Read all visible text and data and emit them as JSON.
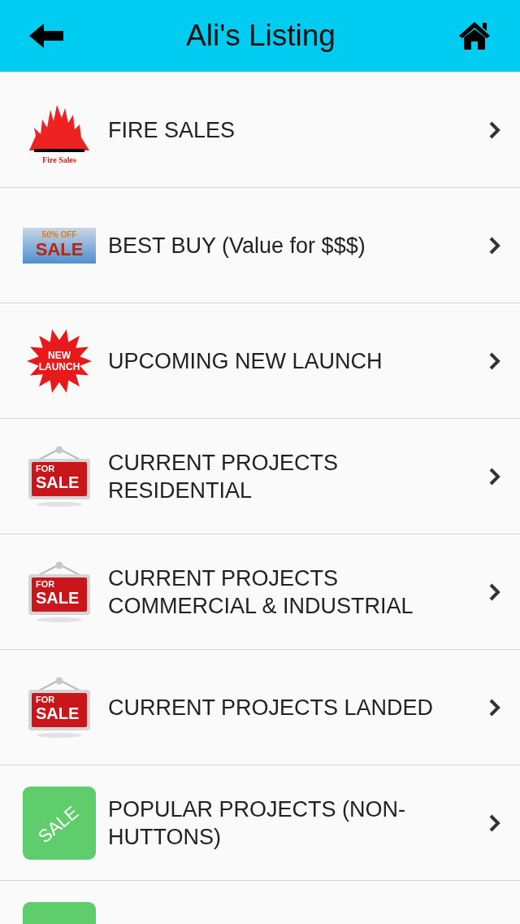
{
  "header": {
    "title": "Ali's Listing"
  },
  "items": [
    {
      "label": "FIRE SALES",
      "icon": {
        "kind": "fire",
        "lines": [
          "Fire Sales"
        ]
      }
    },
    {
      "label": "BEST BUY (Value for $$$)",
      "icon": {
        "kind": "banner",
        "lines": [
          "50% OFF",
          "SALE"
        ]
      }
    },
    {
      "label": "UPCOMING NEW LAUNCH",
      "icon": {
        "kind": "starburst",
        "lines": [
          "NEW",
          "LAUNCH"
        ]
      }
    },
    {
      "label": "CURRENT PROJECTS RESIDENTIAL",
      "icon": {
        "kind": "sign",
        "lines": [
          "FOR",
          "SALE"
        ]
      }
    },
    {
      "label": "CURRENT PROJECTS COMMERCIAL & INDUSTRIAL",
      "icon": {
        "kind": "sign",
        "lines": [
          "FOR",
          "SALE"
        ]
      }
    },
    {
      "label": "CURRENT PROJECTS LANDED",
      "icon": {
        "kind": "sign",
        "lines": [
          "FOR",
          "SALE"
        ]
      }
    },
    {
      "label": "POPULAR PROJECTS (NON-HUTTONS)",
      "icon": {
        "kind": "tag",
        "lines": [
          "SALE"
        ]
      }
    },
    {
      "icon": {
        "kind": "tag"
      }
    }
  ]
}
